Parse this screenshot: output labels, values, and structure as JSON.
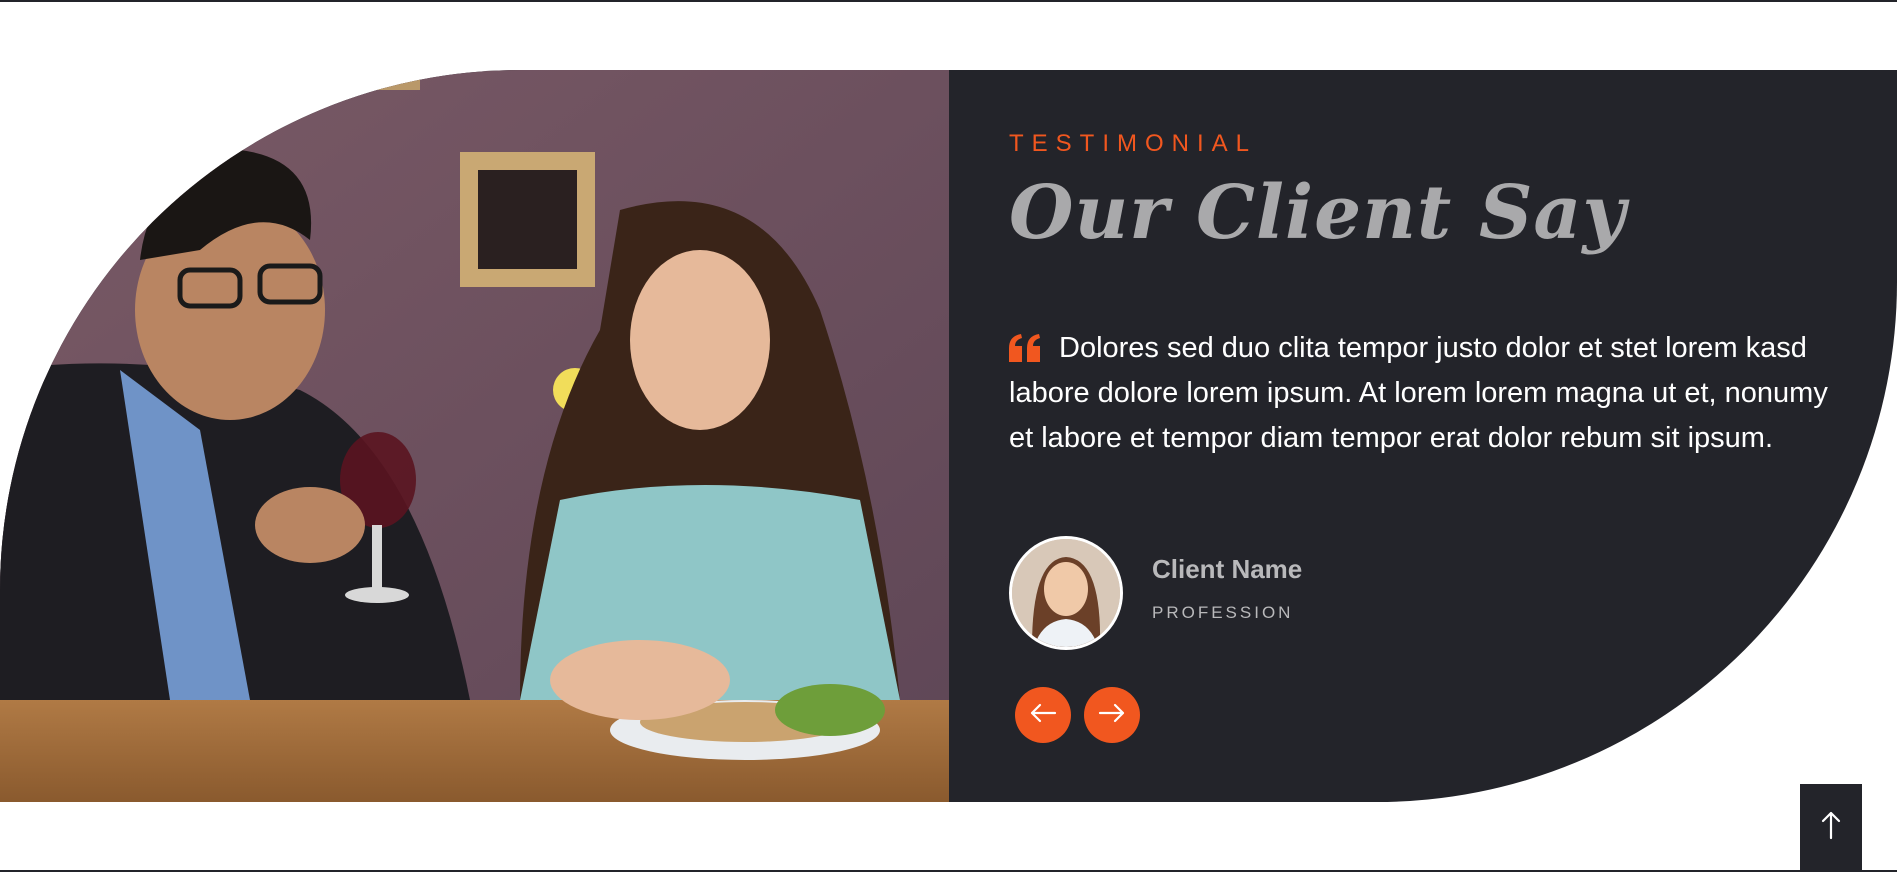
{
  "testimonial": {
    "eyebrow": "TESTIMONIAL",
    "title": "Our Client Say",
    "quote": "Dolores sed duo clita tempor justo dolor et stet lorem kasd labore dolore lorem ipsum. At lorem lorem magna ut et, nonumy et labore et tempor diam tempor erat dolor rebum sit ipsum.",
    "client": {
      "name": "Client Name",
      "profession": "PROFESSION"
    },
    "photo_description_icon": "couple-dining-photo",
    "nav": {
      "prev_icon": "arrow-left-icon",
      "next_icon": "arrow-right-icon"
    }
  },
  "back_to_top_icon": "arrow-up-icon",
  "colors": {
    "accent": "#f1571f",
    "panel": "#23242a",
    "heading": "#a9a9ab",
    "text": "#ffffff",
    "muted": "#b9b9bb"
  }
}
